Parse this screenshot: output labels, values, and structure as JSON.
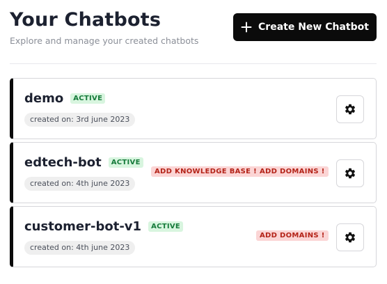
{
  "header": {
    "title": "Your Chatbots",
    "subtitle": "Explore and manage your created chatbots",
    "create_button_label": "Create New Chatbot"
  },
  "chatbots": [
    {
      "name": "demo",
      "status": "ACTIVE",
      "created": "created on: 3rd june 2023",
      "warnings": []
    },
    {
      "name": "edtech-bot",
      "status": "ACTIVE",
      "created": "created on: 4th june 2023",
      "warnings": [
        "ADD KNOWLEDGE BASE !",
        "ADD DOMAINS !"
      ]
    },
    {
      "name": "customer-bot-v1",
      "status": "ACTIVE",
      "created": "created on: 4th june 2023",
      "warnings": [
        "ADD DOMAINS !"
      ]
    }
  ],
  "icons": {
    "create": "plus-icon",
    "settings": "gear-icon"
  },
  "colors": {
    "accent": "#0b0b0b",
    "active_badge_bg": "#d8f5df",
    "active_badge_text": "#157a3a",
    "warning_badge_bg": "#fbd5d5",
    "warning_badge_text": "#b42318"
  }
}
